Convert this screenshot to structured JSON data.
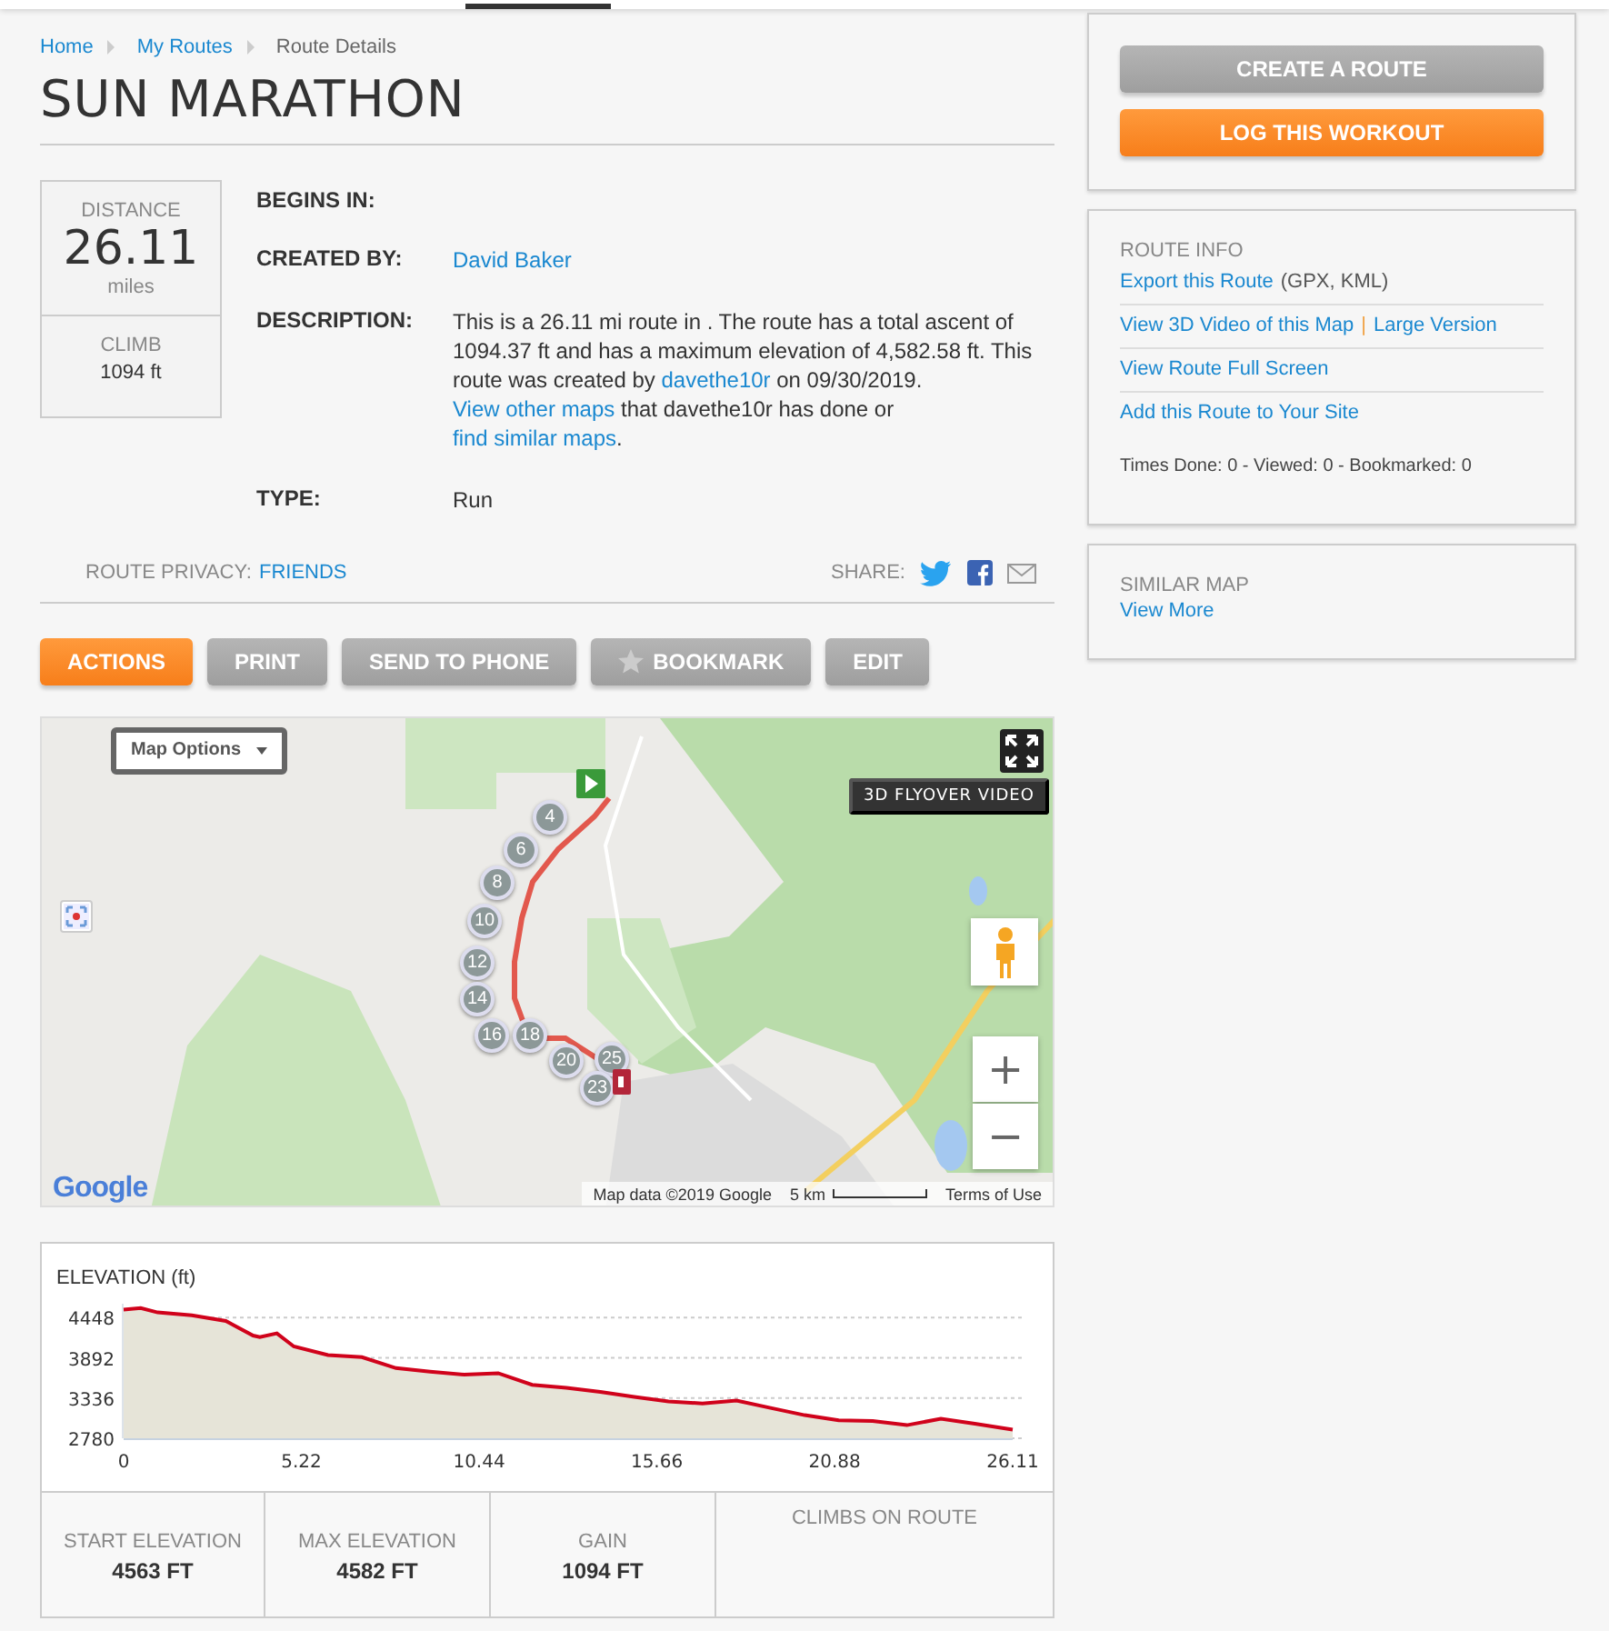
{
  "breadcrumbs": [
    {
      "label": "Home",
      "link": true
    },
    {
      "label": "My Routes",
      "link": true
    },
    {
      "label": "Route Details",
      "link": false
    }
  ],
  "title": "SUN MARATHON",
  "stats": [
    {
      "kind": "large",
      "label": "DISTANCE",
      "value": "26.11",
      "unit": "miles"
    },
    {
      "kind": "small",
      "label": "CLIMB",
      "value": "1094 ft"
    }
  ],
  "details": [
    {
      "kind": "empty",
      "label": "BEGINS IN:"
    },
    {
      "kind": "link",
      "label": "CREATED BY:",
      "value": "David Baker"
    },
    {
      "kind": "paragraph",
      "label": "DESCRIPTION:",
      "segments": [
        {
          "text": "This is a 26.11 mi route in . The route has a total ascent of 1094.37 ft and has a maximum elevation of 4,582.58 ft. This route was created by ",
          "link": false
        },
        {
          "text": "davethe10r",
          "link": true
        },
        {
          "text": " on 09/30/2019. ",
          "link": false
        },
        {
          "text": "View other maps",
          "link": true
        },
        {
          "text": " that davethe10r has done or ",
          "link": false
        },
        {
          "text": "find similar maps",
          "link": true
        },
        {
          "text": ".",
          "link": false
        }
      ]
    },
    {
      "kind": "text",
      "label": "TYPE:",
      "value": "Run"
    }
  ],
  "privacy": {
    "label": "ROUTE PRIVACY:",
    "value": "FRIENDS"
  },
  "share": {
    "label": "SHARE:",
    "icons": [
      {
        "kind": "twitter"
      },
      {
        "kind": "facebook"
      },
      {
        "kind": "mail"
      }
    ]
  },
  "actions": [
    {
      "label": "ACTIONS",
      "primary": true,
      "kind": "plain"
    },
    {
      "label": "PRINT",
      "primary": false,
      "kind": "plain"
    },
    {
      "label": "SEND TO PHONE",
      "primary": false,
      "kind": "plain"
    },
    {
      "label": "BOOKMARK",
      "primary": false,
      "kind": "bookmark"
    },
    {
      "label": "EDIT",
      "primary": false,
      "kind": "plain"
    }
  ],
  "map": {
    "options_label": "Map Options",
    "flyover_label": "3D FLYOVER VIDEO",
    "zoom_in": "+",
    "zoom_out": "−",
    "logo": "Google",
    "attribution": "Map data ©2019 Google",
    "scale": "5 km",
    "terms": "Terms of Use",
    "markers": [
      "4",
      "6",
      "8",
      "10",
      "12",
      "14",
      "16",
      "18",
      "20",
      "25",
      "23"
    ]
  },
  "elevation": {
    "chart_data": {
      "type": "area",
      "title": "ELEVATION (ft)",
      "x": [
        0,
        0.5,
        1,
        2,
        3,
        3.8,
        4,
        4.5,
        5,
        6,
        7,
        8,
        9,
        10,
        11,
        12,
        13,
        14,
        15,
        16,
        17,
        18,
        19,
        20,
        21,
        22,
        23,
        24,
        25,
        26.11
      ],
      "series": [
        {
          "color": "#d0021b",
          "values": [
            4560,
            4580,
            4520,
            4480,
            4400,
            4200,
            4180,
            4230,
            4050,
            3930,
            3900,
            3750,
            3700,
            3660,
            3680,
            3520,
            3480,
            3420,
            3350,
            3290,
            3260,
            3300,
            3200,
            3100,
            3030,
            3020,
            2960,
            3050,
            2980,
            2900
          ]
        }
      ],
      "xlim": [
        0,
        26.11
      ],
      "ylim": [
        2780,
        4640
      ],
      "grid": true,
      "xticks": [
        0,
        5.22,
        10.44,
        15.66,
        20.88,
        26.11
      ],
      "yticks": [
        2780,
        3336,
        3892,
        4448
      ]
    },
    "summary": [
      {
        "label": "START ELEVATION",
        "value": "4563 FT"
      },
      {
        "label": "MAX ELEVATION",
        "value": "4582 FT"
      },
      {
        "label": "GAIN",
        "value": "1094 FT"
      },
      {
        "label": "CLIMBS ON ROUTE"
      }
    ]
  },
  "sidebar": {
    "buttons": [
      {
        "label": "CREATE A ROUTE",
        "primary": false
      },
      {
        "label": "LOG THIS WORKOUT",
        "primary": true
      }
    ],
    "route_info": {
      "heading": "ROUTE INFO",
      "rows": [
        [
          {
            "text": "Export this Route",
            "kind": "link"
          },
          {
            "text": "(GPX, KML)",
            "kind": "text"
          }
        ],
        [
          {
            "text": "View 3D Video of this Map",
            "kind": "link"
          },
          {
            "text": "|",
            "kind": "separator"
          },
          {
            "text": "Large Version",
            "kind": "link"
          }
        ],
        [
          {
            "text": "View Route Full Screen",
            "kind": "link"
          }
        ],
        [
          {
            "text": "Add this Route to Your Site",
            "kind": "link"
          }
        ]
      ],
      "counts": "Times Done: 0 - Viewed: 0 - Bookmarked: 0"
    },
    "similar": {
      "heading": "SIMILAR MAP",
      "link": "View More"
    }
  }
}
